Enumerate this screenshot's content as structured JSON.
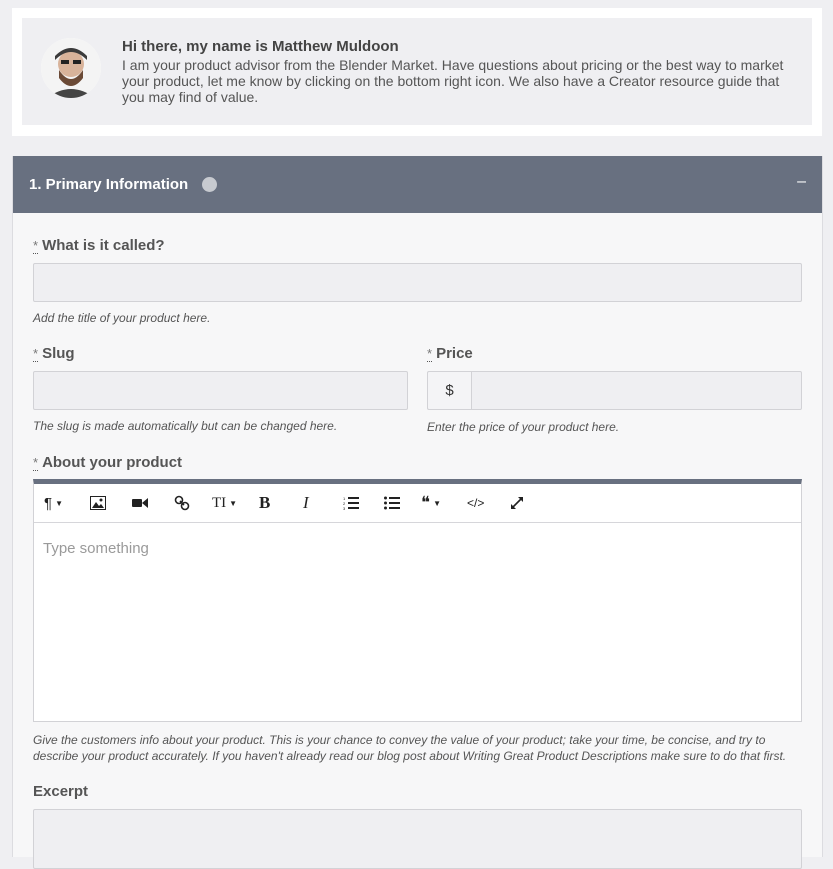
{
  "advisor": {
    "name": "Hi there, my name is Matthew Muldoon",
    "message": "I am your product advisor from the Blender Market. Have questions about pricing or the best way to market your product, let me know by clicking on the bottom right icon. We also have a Creator resource guide that you may find of value."
  },
  "section": {
    "title": "1. Primary Information",
    "collapse_symbol": "–"
  },
  "fields": {
    "required_mark": "*",
    "name": {
      "label": "What is it called?",
      "help": "Add the title of your product here.",
      "value": ""
    },
    "slug": {
      "label": "Slug",
      "help": "The slug is made automatically but can be changed here.",
      "value": ""
    },
    "price": {
      "label": "Price",
      "prefix": "$",
      "help": "Enter the price of your product here.",
      "value": ""
    },
    "about": {
      "label": "About your product",
      "placeholder": "Type something",
      "help": "Give the customers info about your product. This is your chance to convey the value of your product; take your time, be concise, and try to describe your product accurately. If you haven't already read our blog post about Writing Great Product Descriptions make sure to do that first."
    },
    "excerpt": {
      "label": "Excerpt",
      "value": ""
    }
  },
  "toolbar": {
    "paragraph": "¶",
    "text_size": "TI",
    "bold": "B",
    "italic": "I",
    "quote": "❝",
    "code": "</>"
  },
  "colors": {
    "header_bg": "#687080",
    "page_bg": "#efeff2"
  }
}
